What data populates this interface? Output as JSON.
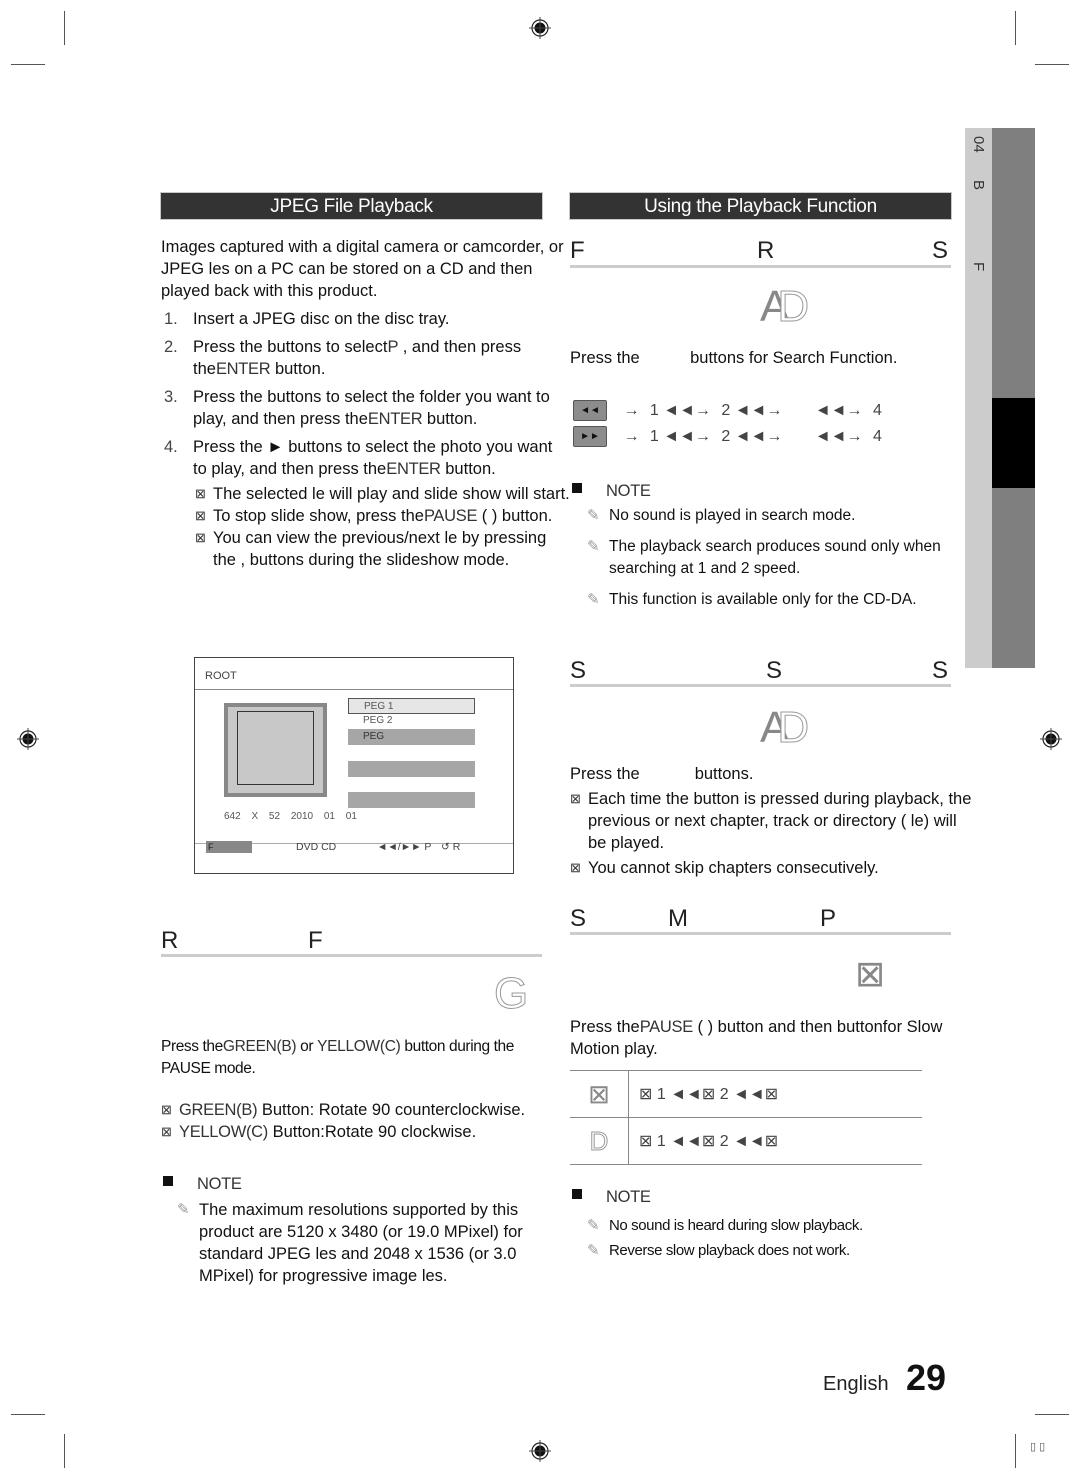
{
  "left": {
    "header_bar": "JPEG File Playback",
    "intro": "Images captured with a digital camera or camcorder, or JPEG    les on a PC can be stored on a CD and then played back with this product.",
    "steps": [
      {
        "num": "1.",
        "text": "Insert a JPEG disc on the disc tray."
      },
      {
        "num": "2.",
        "text_a": "Press the      buttons to select",
        "code_a": "P",
        "text_b": "      , and then press the",
        "code_b": "ENTER",
        "text_c": " button."
      },
      {
        "num": "3.",
        "text_a": "Press the      buttons to select the folder you want to play, and then press the",
        "code_a": "ENTER",
        "text_b": " button."
      },
      {
        "num": "4.",
        "text_a": "Press the      ► buttons to select the photo you want to play, and then press the",
        "code_a": "ENTER",
        "text_b": " button."
      }
    ],
    "bullets": [
      {
        "text": "The selected     le will play and slide show will start."
      },
      {
        "text_a": "To stop slide show, press the",
        "code": "PAUSE",
        "text_b": " (  ) button."
      },
      {
        "text": "You can view the previous/next     le by pressing the     ,     buttons during the slideshow mode."
      }
    ],
    "screen": {
      "root_label": "ROOT",
      "files": [
        "PEG 1",
        "PEG 2",
        "PEG",
        "",
        ""
      ],
      "meta": [
        "642 X",
        "52",
        "2010",
        "01",
        "01"
      ],
      "footer": {
        "f_button": "F",
        "media": "DVD   CD",
        "page_nav": "◄◄/►► P",
        "return": "↺ R"
      }
    },
    "rotate": {
      "title_parts": [
        "R",
        "F"
      ],
      "disc_icon": "G",
      "instruction_a": "Press the",
      "green_code": "GREEN(B)",
      "instruction_b": " or ",
      "yellow_code": "YELLOW(C)",
      "instruction_c": " button during the PAUSE mode.",
      "bullets": [
        {
          "code": "GREEN(B)",
          "text": " Button: Rotate 90     counterclockwise."
        },
        {
          "code": "YELLOW(C)",
          "text": " Button:Rotate 90     clockwise."
        }
      ],
      "note_label": "NOTE",
      "notes": [
        "The maximum resolutions supported by this product are 5120 x 3480 (or 19.0 MPixel) for standard JPEG     les and 2048 x 1536 (or 3.0 MPixel) for progressive image     les."
      ]
    }
  },
  "right": {
    "header_bar": "Using the Playback Function",
    "search": {
      "title_parts": [
        "F",
        "R",
        "S"
      ],
      "disc_icon_a": "A",
      "disc_icon_d": "D",
      "instruction": "Press the           buttons for Search Function.",
      "rows": [
        {
          "key": "◄◄",
          "sequence": [
            "→",
            "1 ◄◄→",
            "2 ◄◄→",
            "",
            "◄◄→",
            "4"
          ]
        },
        {
          "key": "►►",
          "sequence": [
            "→",
            "1 ◄◄→",
            "2 ◄◄→",
            "",
            "◄◄→",
            "4"
          ]
        }
      ],
      "note_label": "NOTE",
      "notes": [
        "No sound is played in search mode.",
        "The playback search produces sound only when searching at    1 and     2 speed.",
        "This function is available only for the CD-DA."
      ]
    },
    "skip": {
      "title_parts": [
        "S",
        "S",
        "S"
      ],
      "disc_icon_a": "A",
      "disc_icon_d": "D",
      "instruction": "Press the            buttons.",
      "bullets": [
        "Each time the button is pressed during playback, the previous or next chapter, track or directory (    le) will be played.",
        "You cannot skip chapters consecutively."
      ]
    },
    "slow": {
      "title_parts": [
        "S",
        "M",
        "P"
      ],
      "disc_icon": "⊠",
      "instruction_a": "Press the",
      "code": "PAUSE",
      "instruction_b": " (  ) button and then      buttonfor Slow Motion play.",
      "table": [
        {
          "icon": "⊠",
          "value": "⊠ 1 ◄◄⊠ 2 ◄◄⊠"
        },
        {
          "icon": "D",
          "value": "⊠ 1 ◄◄⊠ 2 ◄◄⊠"
        }
      ],
      "note_label": "NOTE",
      "notes": [
        "No sound is heard during slow playback.",
        "Reverse slow playback does not work."
      ]
    }
  },
  "side_tab": {
    "labels": [
      "04",
      "B",
      "F"
    ]
  },
  "footer": {
    "language": "English",
    "page_number": "29"
  },
  "corner_glyphs": "▯ ▯"
}
